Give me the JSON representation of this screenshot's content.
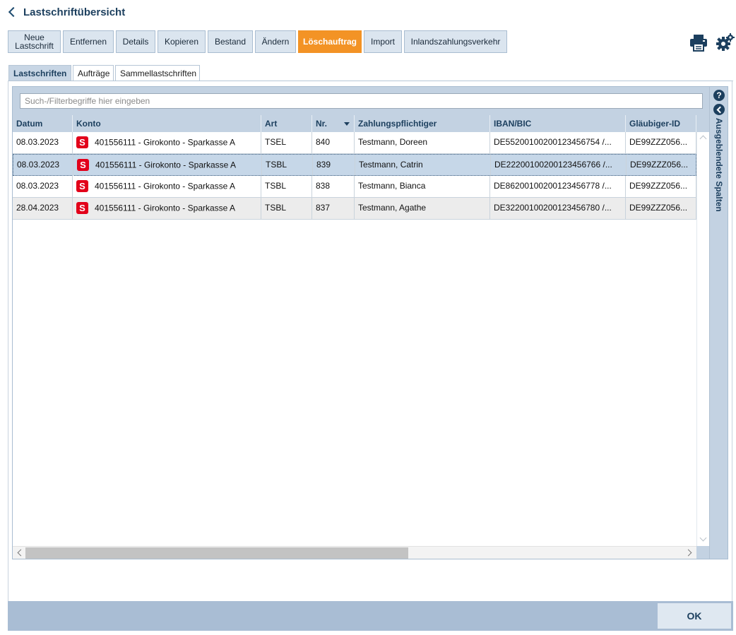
{
  "title": "Lastschriftübersicht",
  "toolbar": {
    "buttons": [
      {
        "label_line1": "Neue",
        "label_line2": "Lastschrift"
      },
      {
        "label": "Entfernen"
      },
      {
        "label": "Details"
      },
      {
        "label": "Kopieren"
      },
      {
        "label": "Bestand"
      },
      {
        "label": "Ändern"
      },
      {
        "label": "Löschauftrag",
        "active": true
      },
      {
        "label": "Import"
      },
      {
        "label": "Inlandszahlungsverkehr"
      }
    ],
    "icons": [
      "printer-icon",
      "settings-icon"
    ]
  },
  "tabs": [
    {
      "label": "Lastschriften",
      "active": true
    },
    {
      "label": "Aufträge"
    },
    {
      "label": "Sammellastschriften"
    }
  ],
  "search": {
    "placeholder": "Such-/Filterbegriffe hier eingeben",
    "value": ""
  },
  "table": {
    "columns": [
      "Datum",
      "Konto",
      "Art",
      "Nr.",
      "Zahlungspflichtiger",
      "IBAN/BIC",
      "Gläubiger-ID"
    ],
    "sorted_column": "Nr.",
    "rows": [
      {
        "datum": "08.03.2023",
        "konto": "401556111 - Girokonto - Sparkasse A",
        "art": "TSEL",
        "nr": "840",
        "zahlungspflichtiger": "Testmann, Doreen",
        "iban": "DE55200100200123456754 /...",
        "glaeubiger": "DE99ZZZ056..."
      },
      {
        "datum": "08.03.2023",
        "konto": "401556111 - Girokonto - Sparkasse A",
        "art": "TSBL",
        "nr": "839",
        "zahlungspflichtiger": "Testmann, Catrin",
        "iban": "DE22200100200123456766 /...",
        "glaeubiger": "DE99ZZZ056...",
        "selected": true
      },
      {
        "datum": "08.03.2023",
        "konto": "401556111 - Girokonto - Sparkasse A",
        "art": "TSBL",
        "nr": "838",
        "zahlungspflichtiger": "Testmann, Bianca",
        "iban": "DE86200100200123456778 /...",
        "glaeubiger": "DE99ZZZ056..."
      },
      {
        "datum": "28.04.2023",
        "konto": "401556111 - Girokonto - Sparkasse A",
        "art": "TSBL",
        "nr": "837",
        "zahlungspflichtiger": "Testmann, Agathe",
        "iban": "DE32200100200123456780 /...",
        "glaeubiger": "DE99ZZZ056..."
      }
    ]
  },
  "side_panel": {
    "label": "Ausgeblendete Spalten",
    "help": "?"
  },
  "footer": {
    "ok_label": "OK"
  },
  "colors": {
    "accent": "#f39325",
    "primary_text": "#1c3f5e",
    "sparkasse_red": "#e2001a",
    "header_bg": "#c3d2e2"
  }
}
